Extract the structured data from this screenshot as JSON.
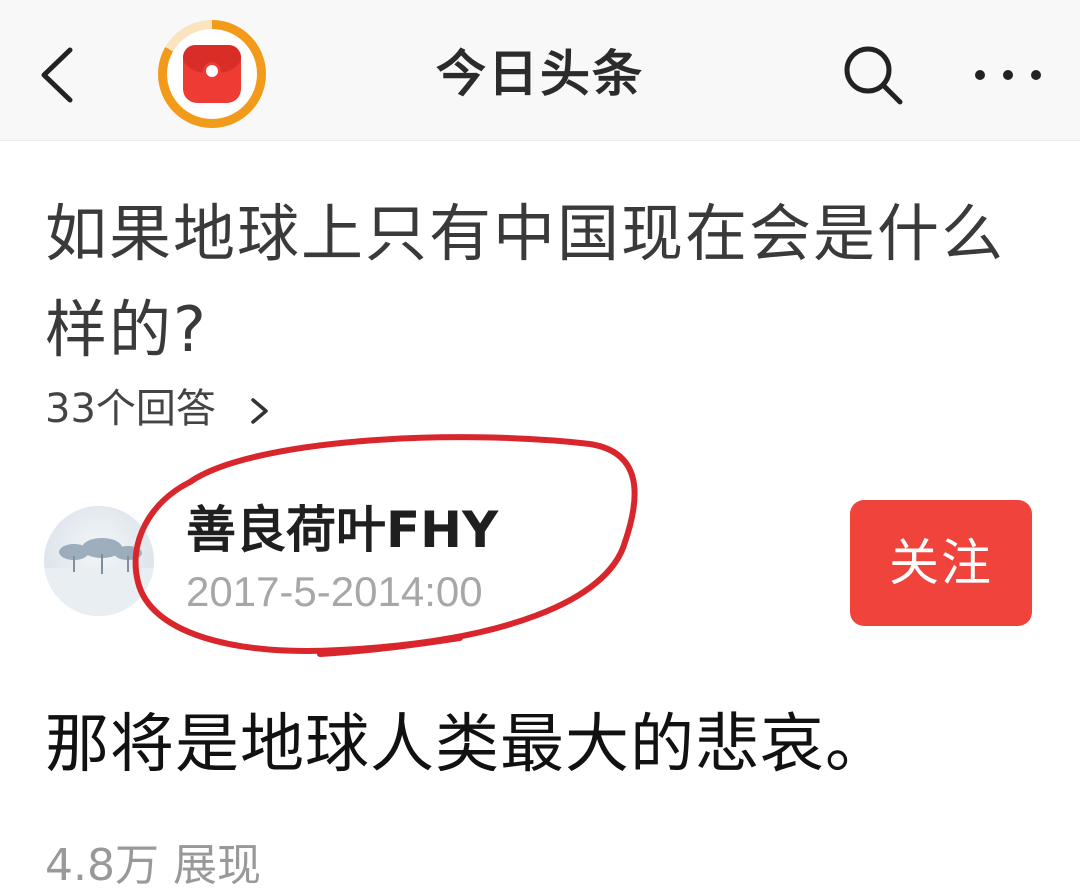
{
  "header": {
    "title": "今日头条",
    "back_icon": "chevron-left-icon",
    "logo_icon": "red-envelope-icon",
    "search_icon": "search-icon",
    "more_icon": "more-dots-icon"
  },
  "question": {
    "title": "如果地球上只有中国现在会是什么样的?",
    "answers_count": "33个回答"
  },
  "author": {
    "name": "善良荷叶FHY",
    "time": "2017-5-2014:00",
    "follow_label": "关注"
  },
  "answer": {
    "text": "那将是地球人类最大的悲哀。",
    "views": "4.8万 展现"
  },
  "colors": {
    "accent": "#f0433b",
    "logo_ring": "#f29a1a",
    "highlight_ring": "#d8262c"
  }
}
